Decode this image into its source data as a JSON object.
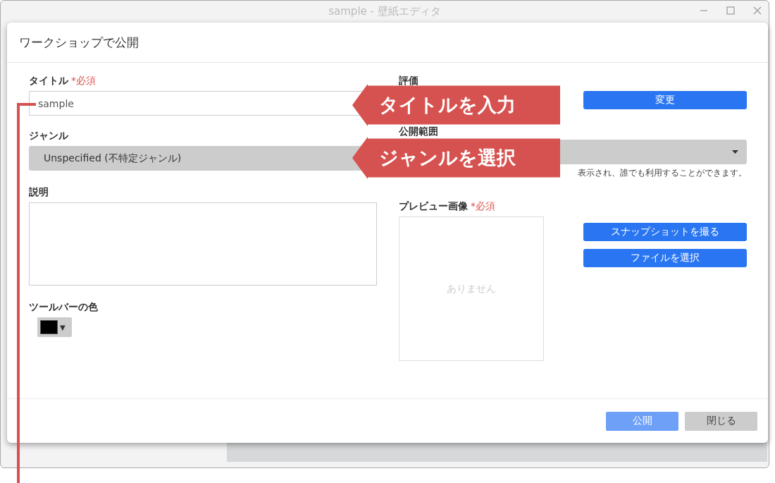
{
  "window": {
    "title": "sample - 壁紙エディタ"
  },
  "dialog": {
    "title": "ワークショップで公開",
    "left": {
      "title_field": {
        "label": "タイトル",
        "required": "*必須",
        "value": "sample"
      },
      "genre": {
        "label": "ジャンル",
        "value": "Unspecified (不特定ジャンル)"
      },
      "description": {
        "label": "説明"
      },
      "toolbar_color": {
        "label": "ツールバーの色",
        "color": "#000000",
        "caret": "▼"
      }
    },
    "right": {
      "rating": {
        "label": "評価",
        "button": "変更"
      },
      "visibility": {
        "label": "公開範囲",
        "hint": "表示され、誰でも利用することができます。"
      },
      "preview": {
        "label": "プレビュー画像",
        "required": "*必須",
        "empty": "ありません",
        "buttons": [
          "スナップショットを撮る",
          "ファイルを選択"
        ]
      }
    },
    "footer": {
      "buttons": [
        {
          "label": "公開",
          "disabled": true
        },
        {
          "label": "閉じる",
          "disabled": false
        }
      ]
    }
  },
  "callouts": [
    "タイトルを入力",
    "ジャンルを選択"
  ]
}
